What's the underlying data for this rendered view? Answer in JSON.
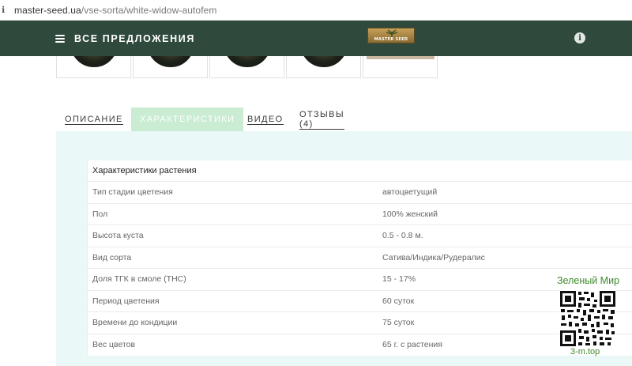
{
  "browser": {
    "url_domain": "master-seed.ua",
    "url_path": "/vse-sorta/white-widow-autofem"
  },
  "nav": {
    "menu_label": "ВСЕ ПРЕДЛОЖЕНИЯ",
    "logo_text": "MASTER SEED",
    "info_label": "i",
    "bg_color": "#2f4a3d"
  },
  "tabs": [
    {
      "label": "ОПИСАНИЕ",
      "active": false
    },
    {
      "label": "ХАРАКТЕРИСТИКИ",
      "active": true
    },
    {
      "label": "ВИДЕО",
      "active": false
    },
    {
      "label": "ОТЗЫВЫ (4)",
      "active": false
    }
  ],
  "characteristics": {
    "title": "Характеристики растения",
    "rows": [
      {
        "name": "Тип стадии цветения",
        "value": "автоцветущий"
      },
      {
        "name": "Пол",
        "value": "100% женский"
      },
      {
        "name": "Высота куста",
        "value": "0.5 - 0.8 м."
      },
      {
        "name": "Вид сорта",
        "value": "Сатива/Индика/Рудералис"
      },
      {
        "name": "Доля ТГК в смоле (THC)",
        "value": "15 - 17%"
      },
      {
        "name": "Период цветения",
        "value": "60 суток"
      },
      {
        "name": "Времени до кондиции",
        "value": "75 суток"
      },
      {
        "name": "Вес цветов",
        "value": "65 г. с растения"
      }
    ]
  },
  "watermark": {
    "title": "Зеленый Мир",
    "site": "3-m.top",
    "color": "#3d8a2b"
  },
  "colors": {
    "active_tab": "#c9ecd3",
    "panel_bg": "#eaf8f8"
  }
}
